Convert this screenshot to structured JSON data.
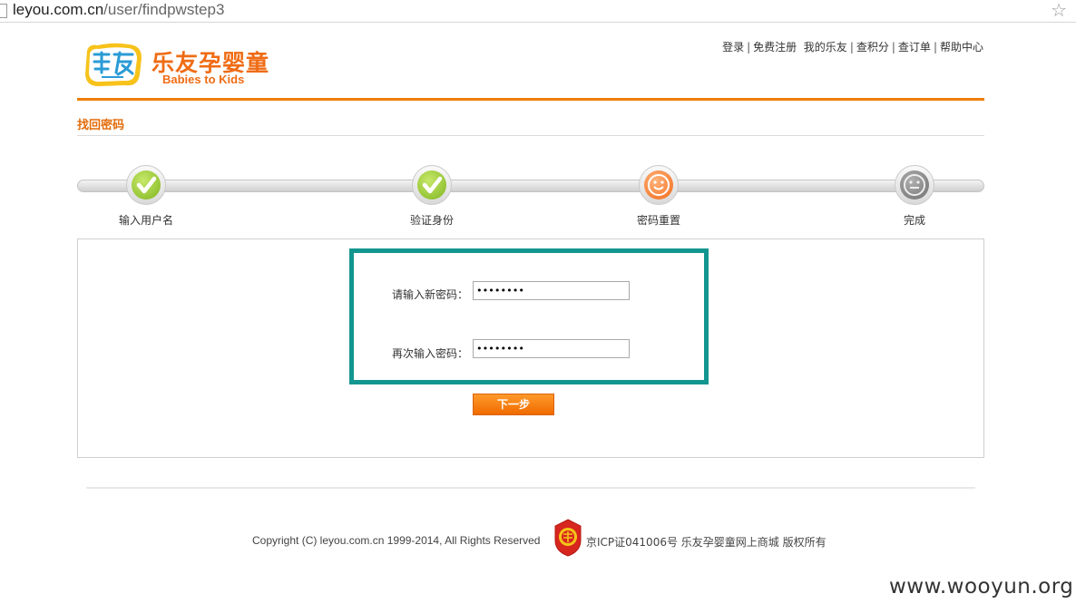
{
  "browser": {
    "url_host": "leyou.com.cn",
    "url_path": "/user/findpwstep3",
    "bookmark_icon": "star-icon"
  },
  "header": {
    "logo_icon": "leyou-logo",
    "brand_cn": "乐友孕婴童",
    "brand_en": "Babies to Kids",
    "nav": [
      "登录",
      "免费注册",
      "我的乐友",
      "查积分",
      "查订单",
      "帮助中心"
    ]
  },
  "page": {
    "section_title": "找回密码"
  },
  "steps": [
    {
      "label": "输入用户名",
      "state": "done",
      "icon": "check-icon"
    },
    {
      "label": "验证身份",
      "state": "done",
      "icon": "check-icon"
    },
    {
      "label": "密码重置",
      "state": "current",
      "icon": "smiley-icon"
    },
    {
      "label": "完成",
      "state": "pending",
      "icon": "smiley-icon"
    }
  ],
  "form": {
    "new_password_label": "请输入新密码：",
    "new_password_value": "••••••••",
    "confirm_password_label": "再次输入密码：",
    "confirm_password_value": "••••••••",
    "next_button": "下一步"
  },
  "footer": {
    "copyright": "Copyright (C) leyou.com.cn 1999-2014, All Rights Reserved",
    "icp": "京ICP证041006号 乐友孕婴童网上商城 版权所有",
    "badge_icon": "police-badge-icon"
  },
  "watermark": "www.wooyun.org",
  "colors": {
    "brand_orange": "#ef7d00",
    "highlight_teal": "#13968f",
    "step_done_green": "#7fb51f",
    "step_current_orange": "#f26a1b",
    "step_pending_gray": "#6e6e6e"
  }
}
